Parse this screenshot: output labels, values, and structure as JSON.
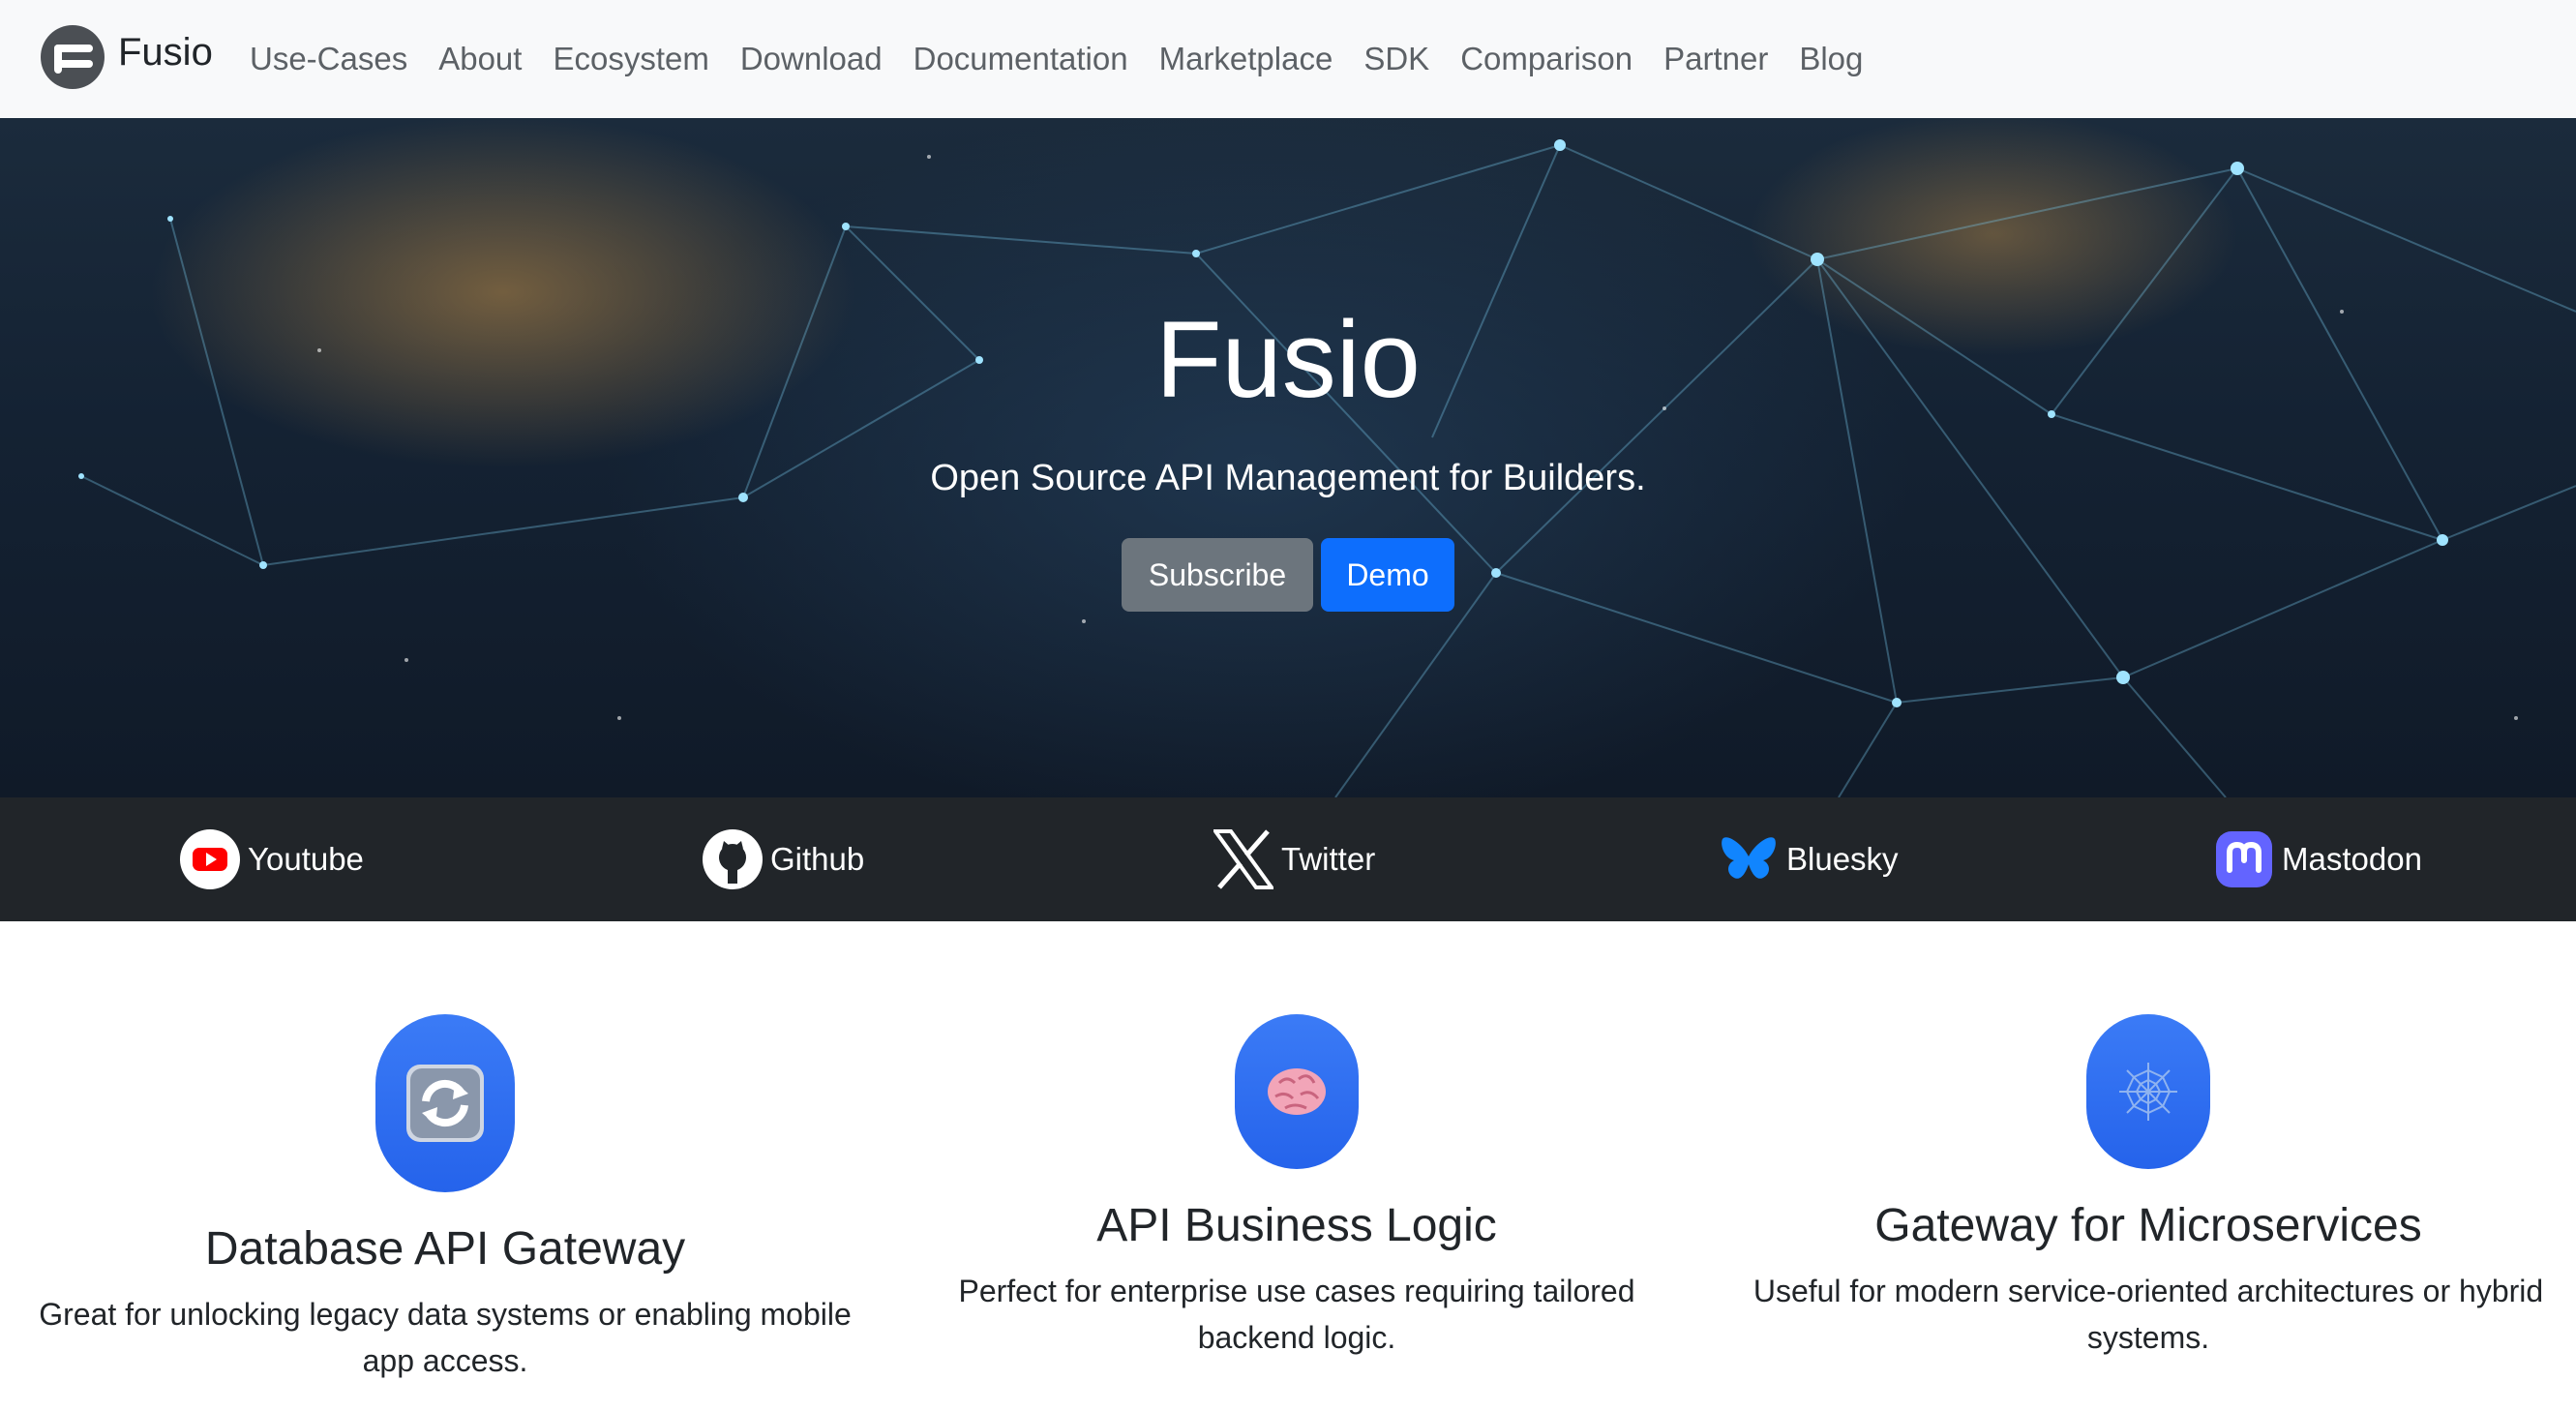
{
  "brand": {
    "name": "Fusio",
    "logo_icon": "fusio-logo-icon"
  },
  "nav": {
    "links": [
      "Use-Cases",
      "About",
      "Ecosystem",
      "Download",
      "Documentation",
      "Marketplace",
      "SDK",
      "Comparison",
      "Partner",
      "Blog"
    ]
  },
  "hero": {
    "title": "Fusio",
    "subtitle": "Open Source API Management for Builders.",
    "subscribe_label": "Subscribe",
    "demo_label": "Demo"
  },
  "social": [
    {
      "label": "Youtube",
      "icon": "youtube-icon",
      "color": "#ff0000"
    },
    {
      "label": "Github",
      "icon": "github-icon",
      "color": "#ffffff"
    },
    {
      "label": "Twitter",
      "icon": "x-twitter-icon",
      "color": "#ffffff"
    },
    {
      "label": "Bluesky",
      "icon": "bluesky-butterfly-icon",
      "color": "#1185fe"
    },
    {
      "label": "Mastodon",
      "icon": "mastodon-icon",
      "color": "#6364ff"
    }
  ],
  "features": [
    {
      "title": "Database API Gateway",
      "description": "Great for unlocking legacy data systems or enabling mobile app access.",
      "icon": "sync-arrows-icon"
    },
    {
      "title": "API Business Logic",
      "description": "Perfect for enterprise use cases requiring tailored backend logic.",
      "icon": "brain-icon"
    },
    {
      "title": "Gateway for Microservices",
      "description": "Useful for modern service-oriented architectures or hybrid systems.",
      "icon": "spider-web-icon"
    }
  ],
  "colors": {
    "primary": "#0d6efd",
    "secondary": "#6c757d",
    "dark": "#212529",
    "navbar_bg": "#f8f9fa"
  }
}
